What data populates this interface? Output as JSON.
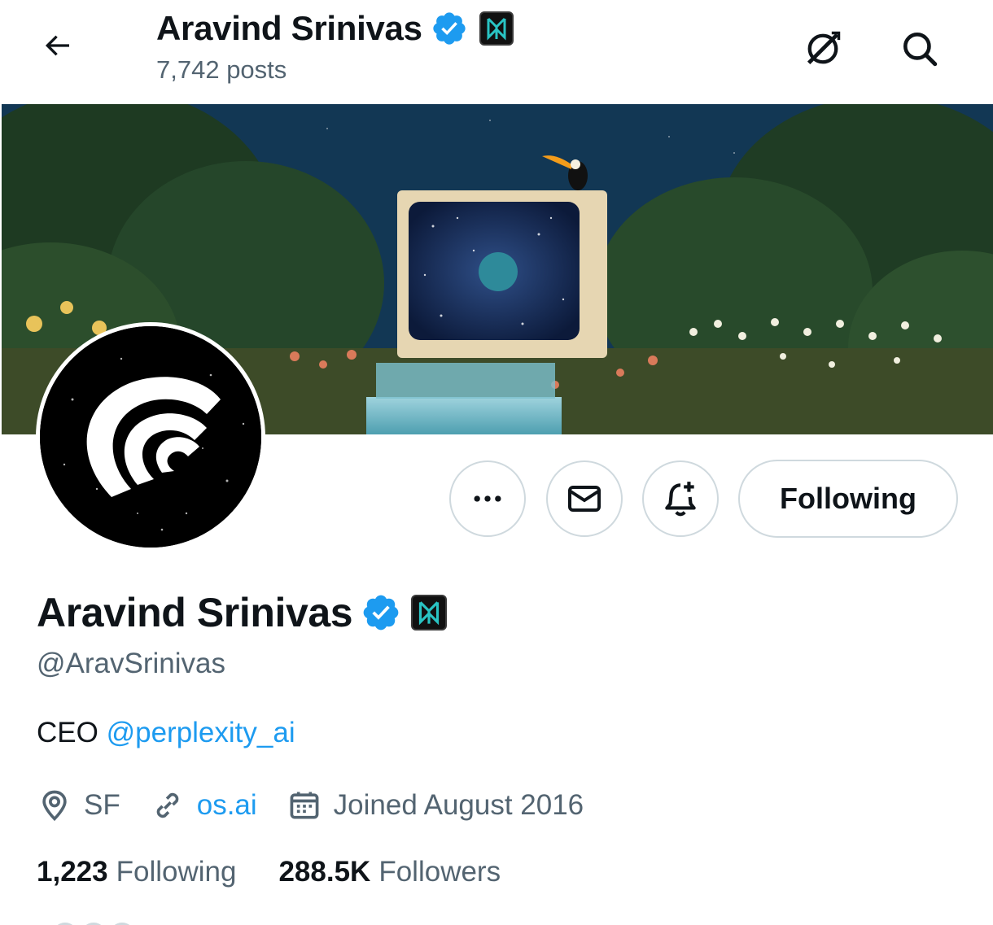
{
  "header": {
    "title": "Aravind Srinivas",
    "posts": "7,742 posts"
  },
  "profile": {
    "name": "Aravind Srinivas",
    "handle": "@AravSrinivas",
    "bio_prefix": "CEO ",
    "bio_link": "@perplexity_ai",
    "location": "SF",
    "website": "os.ai",
    "joined": "Joined August 2016",
    "following_count": "1,223",
    "following_label": "Following",
    "followers_count": "288.5K",
    "followers_label": "Followers"
  },
  "actions": {
    "follow_label": "Following"
  },
  "icons": {
    "back": "arrow-left-icon",
    "grok": "grok-icon",
    "search": "search-icon",
    "more": "more-icon",
    "message": "mail-icon",
    "notify": "bell-plus-icon",
    "verified": "verified-badge-icon",
    "location": "location-pin-icon",
    "link": "link-icon",
    "calendar": "calendar-icon"
  },
  "colors": {
    "accent": "#1d9bf0",
    "text_primary": "#0f1419",
    "text_secondary": "#536471",
    "border": "#cfd9de"
  }
}
